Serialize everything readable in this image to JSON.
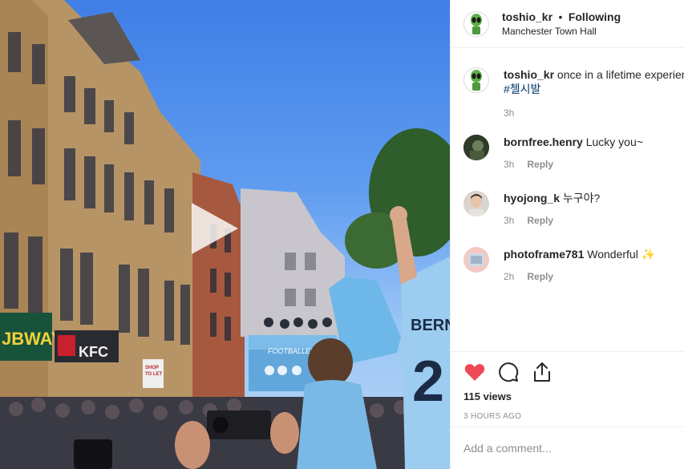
{
  "post": {
    "username": "toshio_kr",
    "separator": "•",
    "following_label": "Following",
    "location": "Manchester Town Hall"
  },
  "media": {
    "type": "video",
    "signs": {
      "subway": "JBWAY",
      "kfc": "KFC",
      "shop_to_let_1": "SHOP",
      "shop_to_let_2": "TO LET",
      "bus": "FOOTBALLER",
      "jersey_name": "BERN",
      "jersey_number": "2"
    }
  },
  "caption": {
    "username": "toshio_kr",
    "text": "once in a lifetime experience",
    "hashtag": "#첼시발",
    "time": "3h"
  },
  "comments": [
    {
      "username": "bornfree.henry",
      "text": "Lucky you~",
      "time": "3h",
      "reply_label": "Reply"
    },
    {
      "username": "hyojong_k",
      "text": "누구야?",
      "time": "3h",
      "reply_label": "Reply"
    },
    {
      "username": "photoframe781",
      "text": "Wonderful",
      "emoji": "✨",
      "time": "2h",
      "reply_label": "Reply"
    }
  ],
  "actions": {
    "like_icon": "heart-filled-icon",
    "comment_icon": "comment-bubble-icon",
    "share_icon": "share-upload-icon",
    "like_color": "#ed4956"
  },
  "views": "115 views",
  "posted": "3 HOURS AGO",
  "add_comment": {
    "placeholder": "Add a comment..."
  }
}
